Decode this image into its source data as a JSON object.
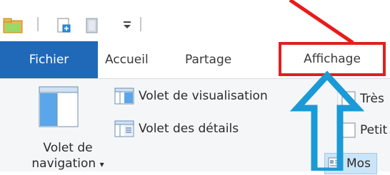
{
  "tabs": {
    "file": "Fichier",
    "home": "Accueil",
    "share": "Partage",
    "view": "Affichage"
  },
  "ribbon": {
    "nav_pane_line1": "Volet de",
    "nav_pane_line2": "navigation",
    "nav_pane_arrow": "▾",
    "preview_pane": "Volet de visualisation",
    "details_pane": "Volet des détails"
  },
  "layout": {
    "item1": "Très",
    "item2": "Petit",
    "item3": "Mos"
  },
  "colors": {
    "file_tab": "#1f69b8",
    "highlight_box": "#e02020",
    "arrow": "#1a9ad6",
    "selected_item": "#cce4f7"
  },
  "icons": {
    "folder": "folder-icon",
    "properties": "properties-icon",
    "new_folder": "new-folder-icon",
    "qat_dropdown": "qat-dropdown-icon",
    "nav_pane": "navigation-pane-icon",
    "preview_pane": "preview-pane-icon",
    "details_pane": "details-pane-icon",
    "large_icons": "large-icons-icon",
    "small_icons": "small-icons-icon",
    "tiles": "tiles-icon"
  }
}
